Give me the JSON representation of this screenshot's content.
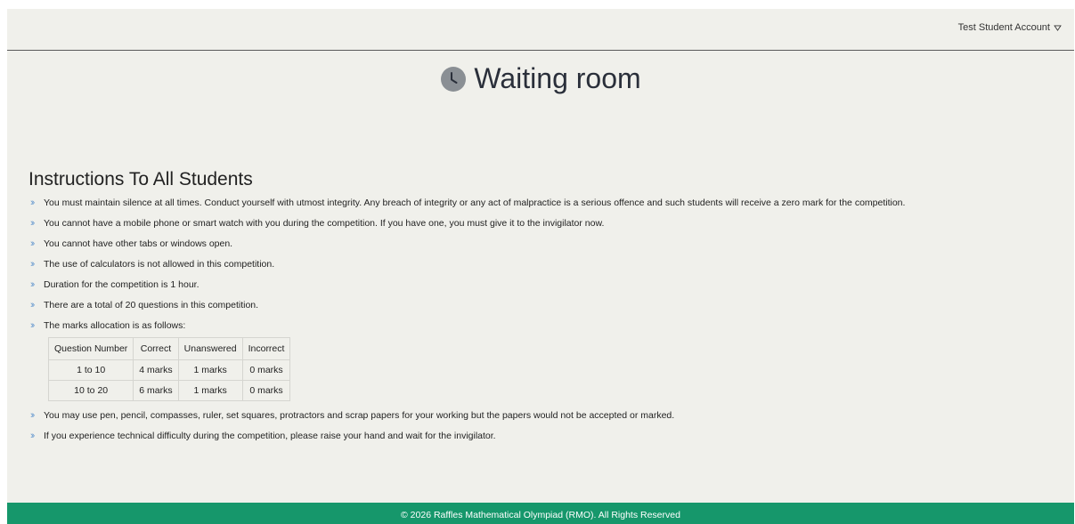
{
  "header": {
    "account_label": "Test Student Account",
    "account_caret_icon": "chevron-down-icon"
  },
  "page": {
    "title": "Waiting room",
    "title_icon": "clock-icon"
  },
  "instructions": {
    "heading": "Instructions To All Students",
    "bullet_icon": "double-chevron-right-icon",
    "items": [
      "You must maintain silence at all times. Conduct yourself with utmost integrity. Any breach of integrity or any act of malpractice is a serious offence and such students will receive a zero mark for the competition.",
      "You cannot have a mobile phone or smart watch with you during the competition. If you have one, you must give it to the invigilator now.",
      "You cannot have other tabs or windows open.",
      "The use of calculators is not allowed in this competition.",
      "Duration for the competition is 1 hour.",
      "There are a total of 20 questions in this competition.",
      "The marks allocation is as follows:",
      "You may use pen, pencil, compasses, ruler, set squares, protractors and scrap papers for your working but the papers would not be accepted or marked.",
      "If you experience technical difficulty during the competition, please raise your hand and wait for the invigilator."
    ],
    "marks_table": {
      "headers": [
        "Question Number",
        "Correct",
        "Unanswered",
        "Incorrect"
      ],
      "rows": [
        [
          "1 to 10",
          "4 marks",
          "1 marks",
          "0 marks"
        ],
        [
          "10 to 20",
          "6 marks",
          "1 marks",
          "0 marks"
        ]
      ]
    }
  },
  "footer": {
    "text": "© 2026 Raffles Mathematical Olympiad (RMO). All Rights Reserved"
  },
  "colors": {
    "background": "#f0f0eb",
    "footer": "#16976b",
    "bullet": "#6a9bd0",
    "title": "#2a2f3a"
  }
}
